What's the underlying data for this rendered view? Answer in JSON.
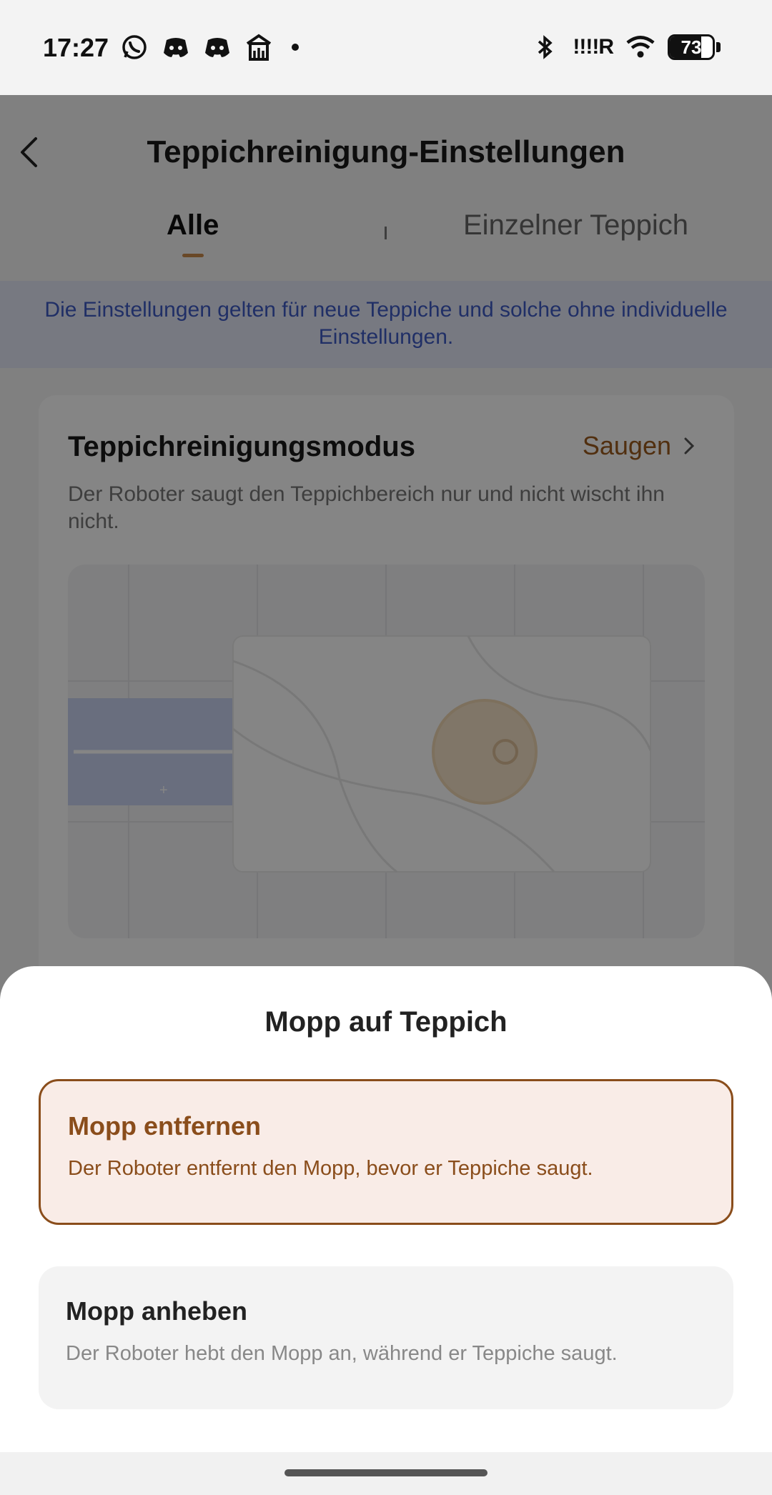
{
  "status_bar": {
    "time": "17:27",
    "signal_text": "!!!!R",
    "battery_level": "73"
  },
  "header": {
    "title": "Teppichreinigung-Einstellungen"
  },
  "tabs": [
    {
      "label": "Alle",
      "active": true
    },
    {
      "label": "Einzelner Teppich",
      "active": false
    }
  ],
  "info_banner": "Die Einstellungen gelten für neue Teppiche und solche ohne individuelle Einstellungen.",
  "card": {
    "title": "Teppichreinigungsmodus",
    "value": "Saugen",
    "description": "Der Roboter saugt den Teppichbereich nur und nicht wischt ihn nicht."
  },
  "sheet": {
    "title": "Mopp auf Teppich",
    "options": [
      {
        "title": "Mopp entfernen",
        "description": "Der Roboter entfernt den Mopp, bevor er Teppiche saugt.",
        "selected": true
      },
      {
        "title": "Mopp anheben",
        "description": "Der Roboter hebt den Mopp an, während er Teppiche saugt.",
        "selected": false
      }
    ]
  },
  "colors": {
    "accent": "#8a4d1b",
    "selected_bg": "#f9ece7",
    "banner_text": "#3f5bc4",
    "banner_bg": "#e4e8f8"
  }
}
